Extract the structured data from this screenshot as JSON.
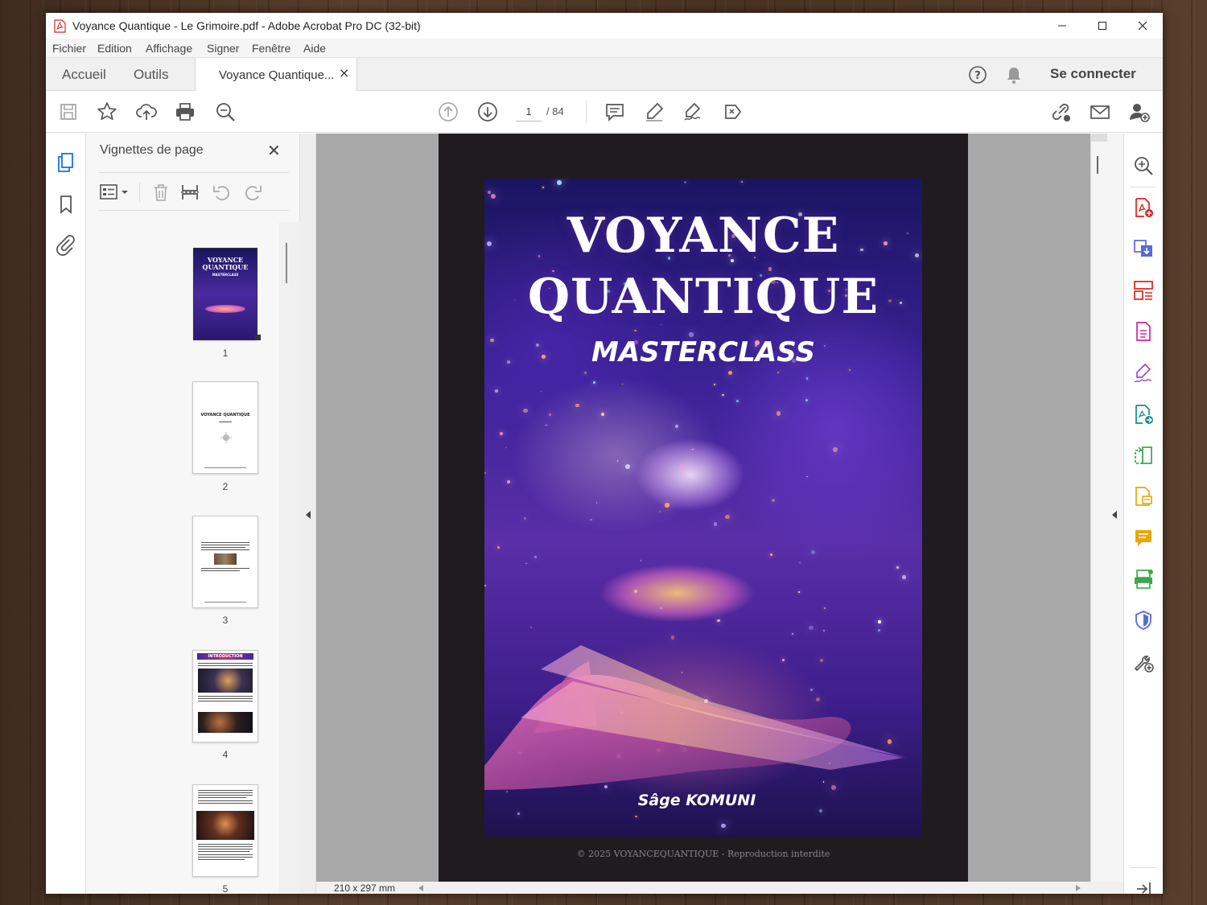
{
  "window": {
    "title": "Voyance Quantique - Le Grimoire.pdf - Adobe Acrobat Pro DC (32-bit)"
  },
  "menu": {
    "items": [
      "Fichier",
      "Edition",
      "Affichage",
      "Signer",
      "Fenêtre",
      "Aide"
    ]
  },
  "tabs": {
    "home": "Accueil",
    "tools": "Outils",
    "document": "Voyance Quantique...",
    "close_glyph": "×",
    "sign_in": "Se connecter"
  },
  "toolbar": {
    "current_page": "1",
    "total_pages": "/ 84",
    "icons": [
      "save-icon",
      "star-icon",
      "upload-icon",
      "print-icon",
      "zoom-search-icon",
      "page-up-icon",
      "page-down-icon",
      "comment-icon",
      "highlight-pen-icon",
      "sign-icon",
      "stamp-icon",
      "share-link-icon",
      "email-icon",
      "add-user-icon"
    ]
  },
  "thumbnails_panel": {
    "title": "Vignettes de page",
    "close_glyph": "✕",
    "pages": [
      "1",
      "2",
      "3",
      "4",
      "5"
    ],
    "page2_heading": "VOYANCE QUANTIQUE",
    "page4_heading": "INTRODUCTION"
  },
  "document": {
    "cover_title_line1": "VOYANCE",
    "cover_title_line2": "QUANTIQUE",
    "cover_subtitle": "MASTERCLASS",
    "cover_author": "Sâge KOMUNI",
    "copyright": "© 2025 VOYANCEQUANTIQUE - Reproduction interdite",
    "page_size": "210 x 297 mm"
  },
  "colors": {
    "acrobat_red": "#d9241b",
    "accent_blue": "#1473e6",
    "tool_purple": "#9b4dca",
    "tool_green": "#3da74e",
    "tool_yellow": "#e8a80b"
  }
}
